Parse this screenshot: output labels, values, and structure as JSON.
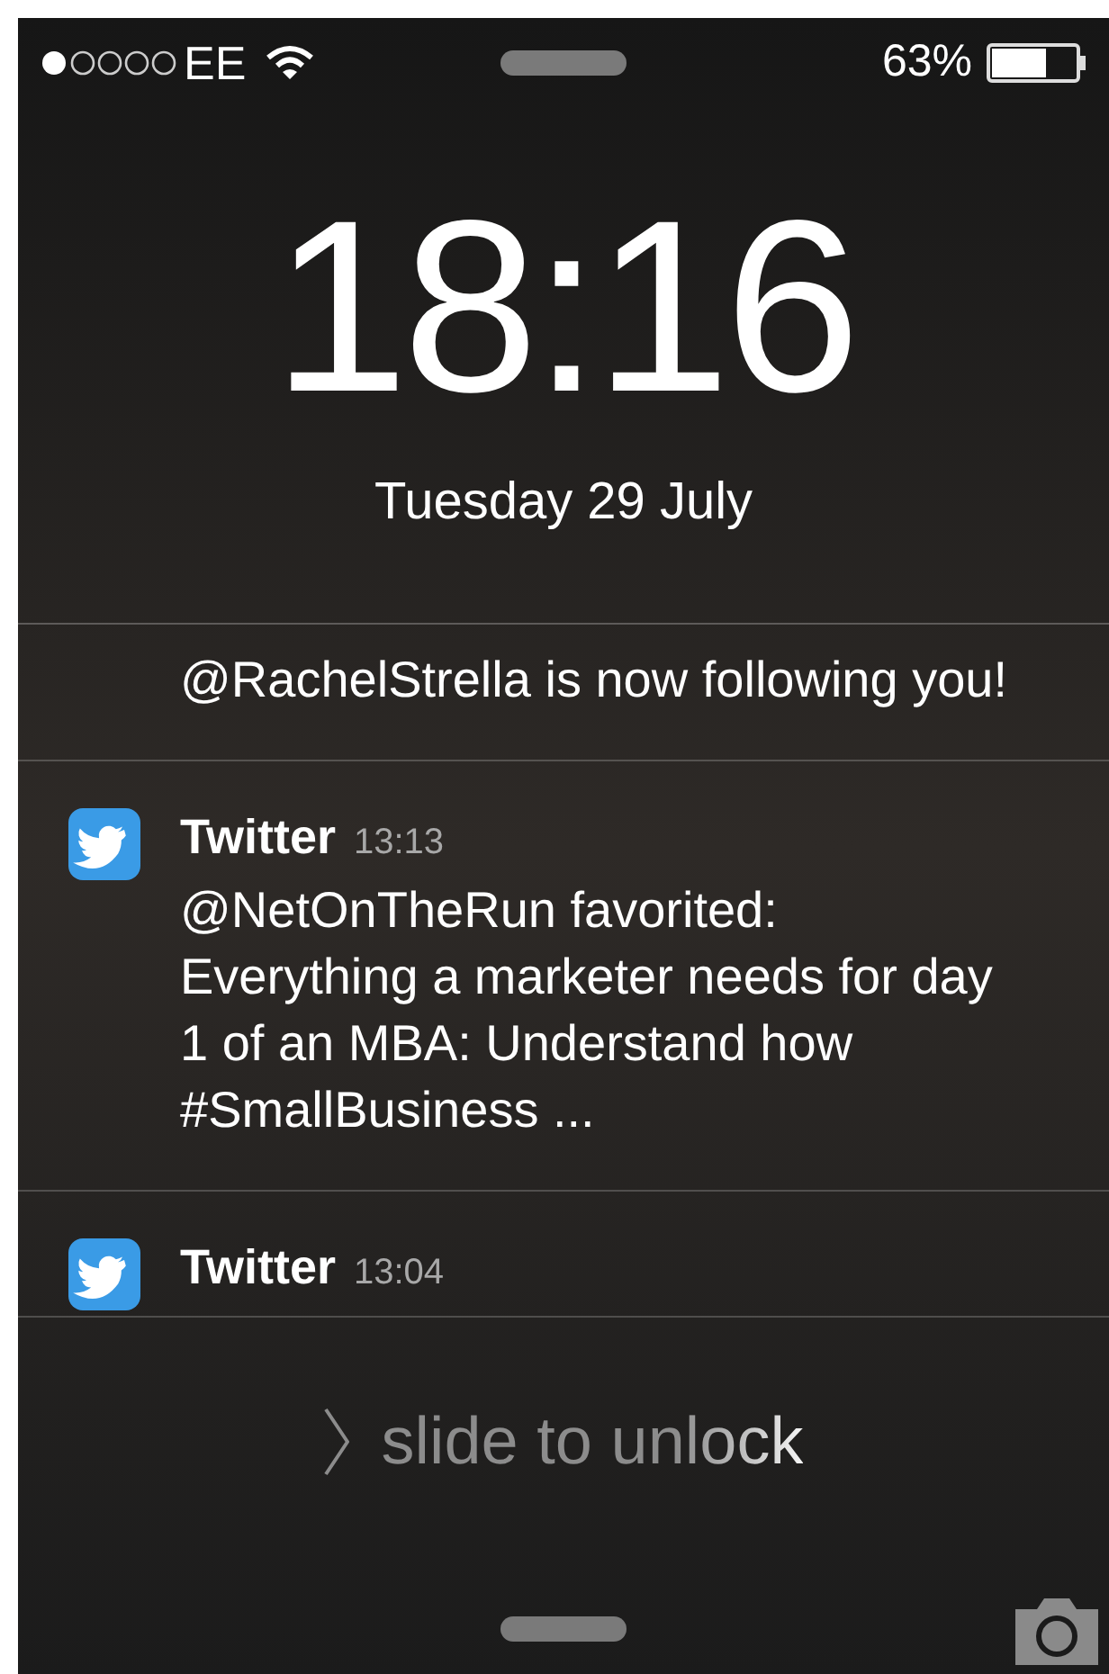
{
  "status_bar": {
    "carrier": "EE",
    "battery": "63%"
  },
  "clock": {
    "time": "18:16",
    "date": "Tuesday 29 July"
  },
  "notifications": [
    {
      "message": "@RachelStrella is now following you!"
    },
    {
      "app": "Twitter",
      "time": "13:13",
      "message": "@NetOnTheRun favorited: Everything a marketer needs for day 1 of an MBA: Understand how #SmallBusiness ..."
    },
    {
      "app": "Twitter",
      "time": "13:04"
    }
  ],
  "unlock": {
    "label": "slide to unlock"
  }
}
